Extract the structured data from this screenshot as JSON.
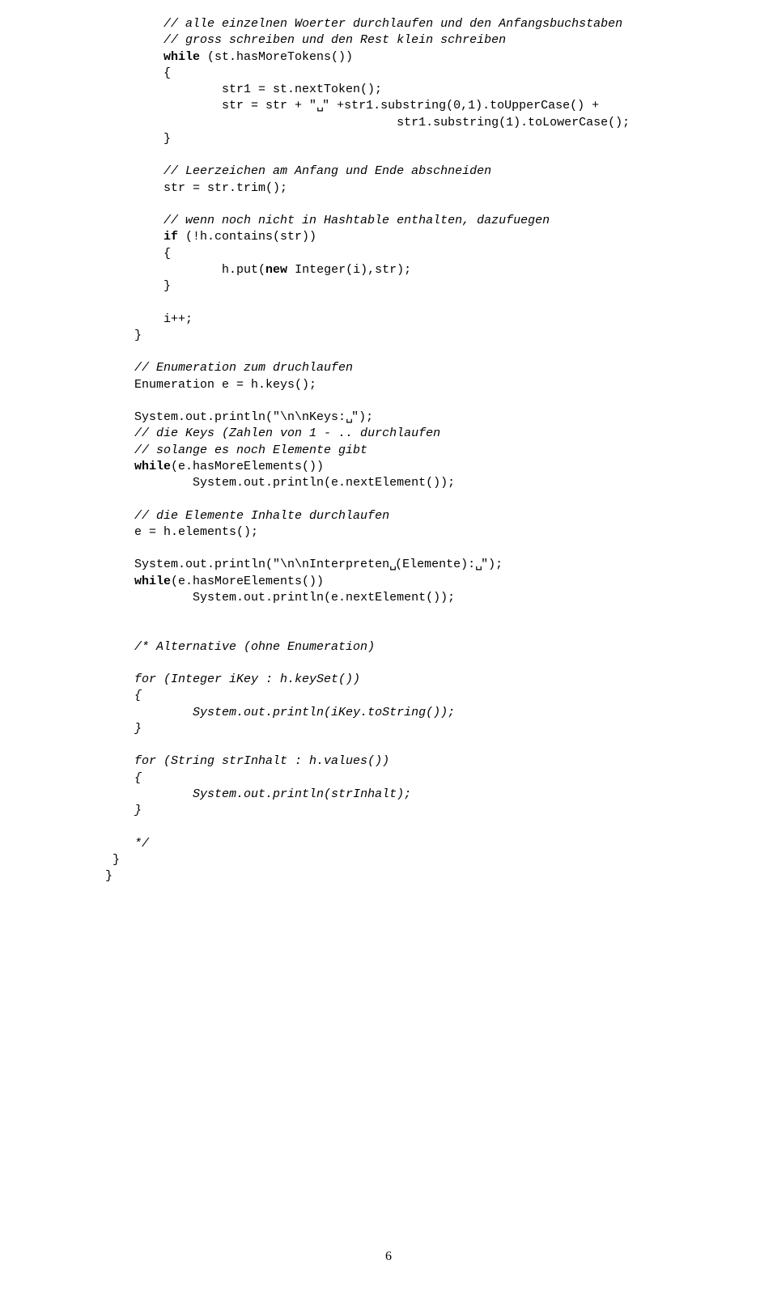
{
  "lines": [
    {
      "indent": 2,
      "segments": [
        {
          "t": "// alle einzelnen Woerter durchlaufen und den Anfangsbuchstaben",
          "cls": "comment"
        }
      ]
    },
    {
      "indent": 2,
      "segments": [
        {
          "t": "// gross schreiben und den Rest klein schreiben",
          "cls": "comment"
        }
      ]
    },
    {
      "indent": 2,
      "segments": [
        {
          "t": "while",
          "cls": "kw"
        },
        {
          "t": " (st.hasMoreTokens())"
        }
      ]
    },
    {
      "indent": 2,
      "segments": [
        {
          "t": "{"
        }
      ]
    },
    {
      "indent": 4,
      "segments": [
        {
          "t": "str1 = st.nextToken();"
        }
      ]
    },
    {
      "indent": 4,
      "segments": [
        {
          "t": "str = str + \""
        },
        {
          "t": "␣",
          "cls": "vs"
        },
        {
          "t": "\" +str1.substring(0,1).toUpperCase() +"
        }
      ]
    },
    {
      "indent": 10,
      "segments": [
        {
          "t": "str1.substring(1).toLowerCase();"
        }
      ]
    },
    {
      "indent": 2,
      "segments": [
        {
          "t": "}"
        }
      ]
    },
    {
      "indent": 0,
      "segments": [
        {
          "t": ""
        }
      ]
    },
    {
      "indent": 2,
      "segments": [
        {
          "t": "// Leerzeichen am Anfang und Ende abschneiden",
          "cls": "comment"
        }
      ]
    },
    {
      "indent": 2,
      "segments": [
        {
          "t": "str = str.trim();"
        }
      ]
    },
    {
      "indent": 0,
      "segments": [
        {
          "t": ""
        }
      ]
    },
    {
      "indent": 2,
      "segments": [
        {
          "t": "// wenn noch nicht in Hashtable enthalten, dazufuegen",
          "cls": "comment"
        }
      ]
    },
    {
      "indent": 2,
      "segments": [
        {
          "t": "if",
          "cls": "kw"
        },
        {
          "t": " (!h.contains(str))"
        }
      ]
    },
    {
      "indent": 2,
      "segments": [
        {
          "t": "{"
        }
      ]
    },
    {
      "indent": 4,
      "segments": [
        {
          "t": "h.put("
        },
        {
          "t": "new",
          "cls": "kw"
        },
        {
          "t": " Integer(i),str);"
        }
      ]
    },
    {
      "indent": 2,
      "segments": [
        {
          "t": "}"
        }
      ]
    },
    {
      "indent": 0,
      "segments": [
        {
          "t": ""
        }
      ]
    },
    {
      "indent": 2,
      "segments": [
        {
          "t": "i++;"
        }
      ]
    },
    {
      "indent": 1,
      "segments": [
        {
          "t": "}"
        }
      ]
    },
    {
      "indent": 0,
      "segments": [
        {
          "t": ""
        }
      ]
    },
    {
      "indent": 1,
      "segments": [
        {
          "t": "// Enumeration zum druchlaufen",
          "cls": "comment"
        }
      ]
    },
    {
      "indent": 1,
      "segments": [
        {
          "t": "Enumeration e = h.keys();"
        }
      ]
    },
    {
      "indent": 0,
      "segments": [
        {
          "t": ""
        }
      ]
    },
    {
      "indent": 1,
      "segments": [
        {
          "t": "System.out.println(\"\\n\\nKeys:"
        },
        {
          "t": "␣",
          "cls": "vs"
        },
        {
          "t": "\");"
        }
      ]
    },
    {
      "indent": 1,
      "segments": [
        {
          "t": "// die Keys (Zahlen von 1 - .. durchlaufen",
          "cls": "comment"
        }
      ]
    },
    {
      "indent": 1,
      "segments": [
        {
          "t": "// solange es noch Elemente gibt",
          "cls": "comment"
        }
      ]
    },
    {
      "indent": 1,
      "segments": [
        {
          "t": "while",
          "cls": "kw"
        },
        {
          "t": "(e.hasMoreElements())"
        }
      ]
    },
    {
      "indent": 3,
      "segments": [
        {
          "t": "System.out.println(e.nextElement());"
        }
      ]
    },
    {
      "indent": 0,
      "segments": [
        {
          "t": ""
        }
      ]
    },
    {
      "indent": 1,
      "segments": [
        {
          "t": "// die Elemente Inhalte durchlaufen",
          "cls": "comment"
        }
      ]
    },
    {
      "indent": 1,
      "segments": [
        {
          "t": "e = h.elements();"
        }
      ]
    },
    {
      "indent": 0,
      "segments": [
        {
          "t": ""
        }
      ]
    },
    {
      "indent": 1,
      "segments": [
        {
          "t": "System.out.println(\"\\n\\nInterpreten"
        },
        {
          "t": "␣",
          "cls": "vs"
        },
        {
          "t": "(Elemente):"
        },
        {
          "t": "␣",
          "cls": "vs"
        },
        {
          "t": "\");"
        }
      ]
    },
    {
      "indent": 1,
      "segments": [
        {
          "t": "while",
          "cls": "kw"
        },
        {
          "t": "(e.hasMoreElements())"
        }
      ]
    },
    {
      "indent": 3,
      "segments": [
        {
          "t": "System.out.println(e.nextElement());"
        }
      ]
    },
    {
      "indent": 0,
      "segments": [
        {
          "t": ""
        }
      ]
    },
    {
      "indent": 0,
      "segments": [
        {
          "t": ""
        }
      ]
    },
    {
      "indent": 1,
      "segments": [
        {
          "t": "/* Alternative (ohne Enumeration)",
          "cls": "comment"
        }
      ]
    },
    {
      "indent": 0,
      "segments": [
        {
          "t": ""
        }
      ]
    },
    {
      "indent": 1,
      "segments": [
        {
          "t": "for (Integer iKey : h.keySet())",
          "cls": "comment"
        }
      ]
    },
    {
      "indent": 1,
      "segments": [
        {
          "t": "{",
          "cls": "comment"
        }
      ]
    },
    {
      "indent": 3,
      "segments": [
        {
          "t": "System.out.println(iKey.toString());",
          "cls": "comment"
        }
      ]
    },
    {
      "indent": 1,
      "segments": [
        {
          "t": "}",
          "cls": "comment"
        }
      ]
    },
    {
      "indent": 0,
      "segments": [
        {
          "t": ""
        }
      ]
    },
    {
      "indent": 1,
      "segments": [
        {
          "t": "for (String strInhalt : h.values())",
          "cls": "comment"
        }
      ]
    },
    {
      "indent": 1,
      "segments": [
        {
          "t": "{",
          "cls": "comment"
        }
      ]
    },
    {
      "indent": 3,
      "segments": [
        {
          "t": "System.out.println(strInhalt);",
          "cls": "comment"
        }
      ]
    },
    {
      "indent": 1,
      "segments": [
        {
          "t": "}",
          "cls": "comment"
        }
      ]
    },
    {
      "indent": 0,
      "segments": [
        {
          "t": ""
        }
      ]
    },
    {
      "indent": 1,
      "segments": [
        {
          "t": "*/",
          "cls": "comment"
        }
      ]
    },
    {
      "indent": 0,
      "segments": [
        {
          "t": " }"
        }
      ]
    },
    {
      "indent": 0,
      "segments": [
        {
          "t": "}"
        }
      ]
    }
  ],
  "indentUnit": "    ",
  "pageNumber": "6"
}
